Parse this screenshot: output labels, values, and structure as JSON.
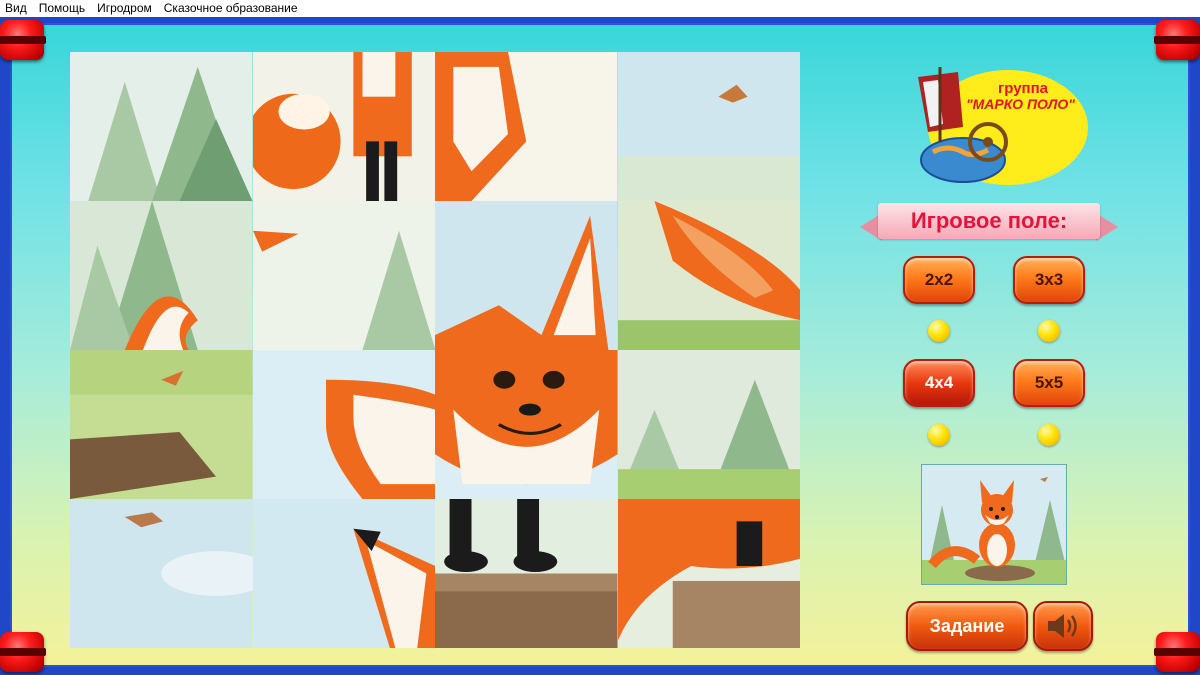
{
  "menu": {
    "items": [
      "Вид",
      "Помощь",
      "Игродром",
      "Сказочное образование"
    ]
  },
  "logo": {
    "line1": "группа",
    "line2": "\"МАРКО ПОЛО\""
  },
  "panel": {
    "title": "Игровое поле:",
    "sizes": [
      "2x2",
      "3x3",
      "4x4",
      "5x5"
    ],
    "selected_size": "4x4"
  },
  "buttons": {
    "task_label": "Задание"
  },
  "icons": {
    "sound": "speaker-icon",
    "corner": "red-lamp-icon"
  },
  "colors": {
    "frame": "#1f47c8",
    "ribbon_text": "#e5133c",
    "button_orange": "#f25a10",
    "fox_orange": "#f06a1e",
    "dot_yellow": "#ffe100"
  }
}
